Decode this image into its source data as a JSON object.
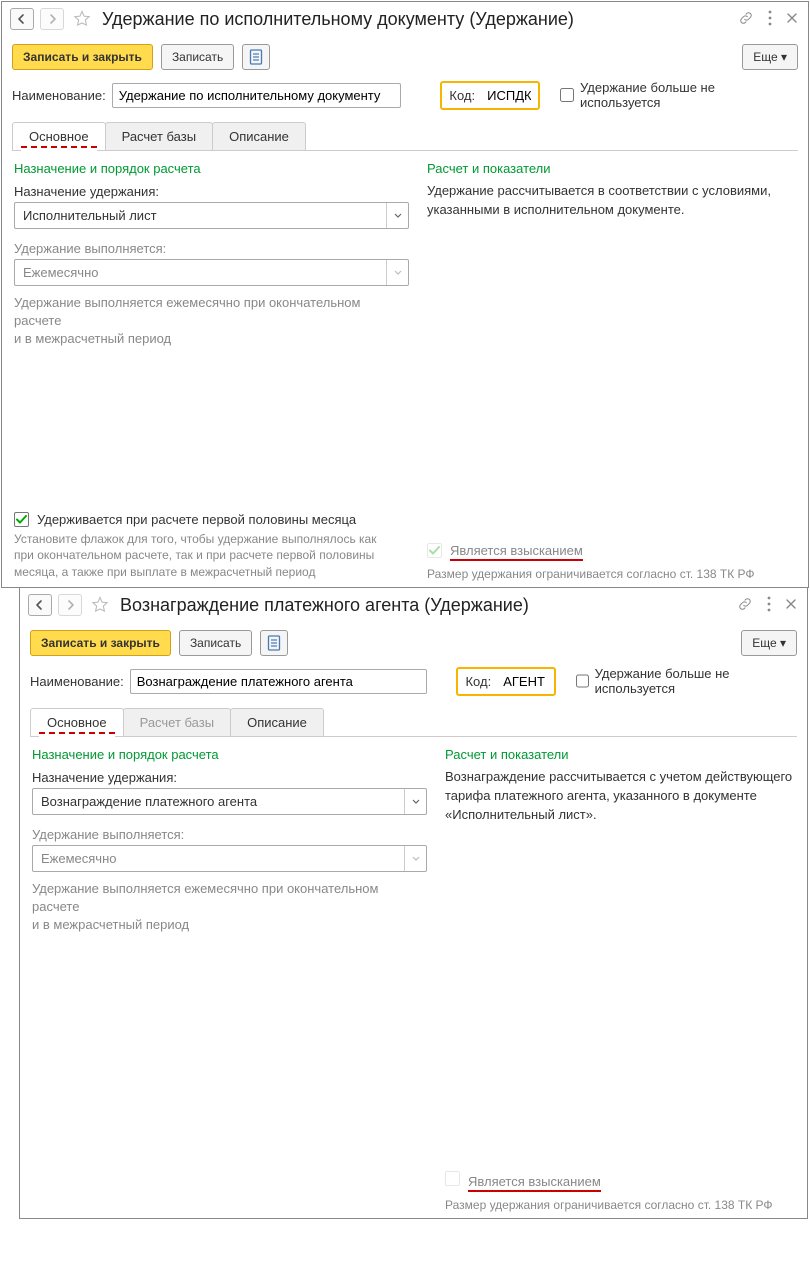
{
  "windows": [
    {
      "title": "Удержание по исполнительному документу (Удержание)",
      "toolbar": {
        "save_close": "Записать и закрыть",
        "save": "Записать",
        "more": "Еще"
      },
      "fields": {
        "name_label": "Наименование:",
        "name_value": "Удержание по исполнительному документу",
        "code_label": "Код:",
        "code_value": "ИСПДК",
        "not_used_label": "Удержание больше не используется"
      },
      "tabs": {
        "t1": "Основное",
        "t2": "Расчет базы",
        "t3": "Описание"
      },
      "left": {
        "section": "Назначение и порядок расчета",
        "purpose_label": "Назначение удержания:",
        "purpose_value": "Исполнительный лист",
        "period_label": "Удержание выполняется:",
        "period_value": "Ежемесячно",
        "desc1": "Удержание выполняется ежемесячно при окончательном расчете",
        "desc2": "и в межрасчетный период",
        "first_half_label": "Удерживается при расчете первой половины месяца",
        "first_half_hint": "Установите флажок для того, чтобы удержание выполнялось как при окончательном расчете, так и при расчете первой половины месяца, а также при выплате в межрасчетный период"
      },
      "right": {
        "section": "Расчет и показатели",
        "desc": "Удержание рассчитывается в соответствии с условиями, указанными в исполнительном документе.",
        "vz_label": "Является взысканием",
        "vz_checked": true,
        "limit": "Размер удержания ограничивается согласно ст. 138 ТК РФ"
      }
    },
    {
      "title": "Вознаграждение платежного агента (Удержание)",
      "toolbar": {
        "save_close": "Записать и закрыть",
        "save": "Записать",
        "more": "Еще"
      },
      "fields": {
        "name_label": "Наименование:",
        "name_value": "Вознаграждение платежного агента",
        "code_label": "Код:",
        "code_value": "АГЕНТ",
        "not_used_label": "Удержание больше не используется"
      },
      "tabs": {
        "t1": "Основное",
        "t2": "Расчет базы",
        "t3": "Описание"
      },
      "left": {
        "section": "Назначение и порядок расчета",
        "purpose_label": "Назначение удержания:",
        "purpose_value": "Вознаграждение платежного агента",
        "period_label": "Удержание выполняется:",
        "period_value": "Ежемесячно",
        "desc1": "Удержание выполняется ежемесячно при окончательном расчете",
        "desc2": "и в межрасчетный период"
      },
      "right": {
        "section": "Расчет и показатели",
        "desc": "Вознаграждение рассчитывается с учетом действующего тарифа платежного агента, указанного в документе «Исполнительный лист».",
        "vz_label": "Является взысканием",
        "vz_checked": false,
        "limit": "Размер удержания ограничивается согласно ст. 138 ТК РФ"
      }
    }
  ]
}
